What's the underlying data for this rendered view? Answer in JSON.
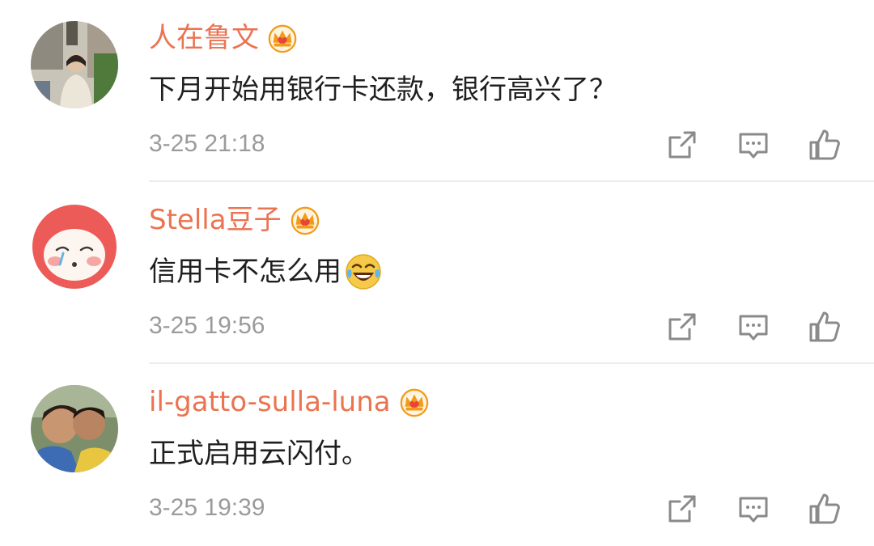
{
  "comments": [
    {
      "username": "人在鲁文",
      "text": "下月开始用银行卡还款，银行高兴了？",
      "time": "3-25 21:18",
      "badge_icon": "vip-crown-icon",
      "actions": [
        "share-icon",
        "comment-icon",
        "like-icon"
      ]
    },
    {
      "username": "Stella豆子",
      "text": "信用卡不怎么用",
      "emoji": "laughing-crying-emoji",
      "time": "3-25 19:56",
      "badge_icon": "vip-crown-icon",
      "actions": [
        "share-icon",
        "comment-icon",
        "like-icon"
      ]
    },
    {
      "username": "il-gatto-sulla-luna",
      "text": "正式启用云闪付。",
      "time": "3-25 19:39",
      "badge_icon": "vip-crown-icon",
      "actions": [
        "share-icon",
        "comment-icon",
        "like-icon"
      ]
    }
  ],
  "colors": {
    "username": "#eb7350",
    "text": "#1f1f1f",
    "meta": "#9b9b9b",
    "divider": "#ececec",
    "icon": "#8a8a8a",
    "crown": "#f29b1a"
  }
}
